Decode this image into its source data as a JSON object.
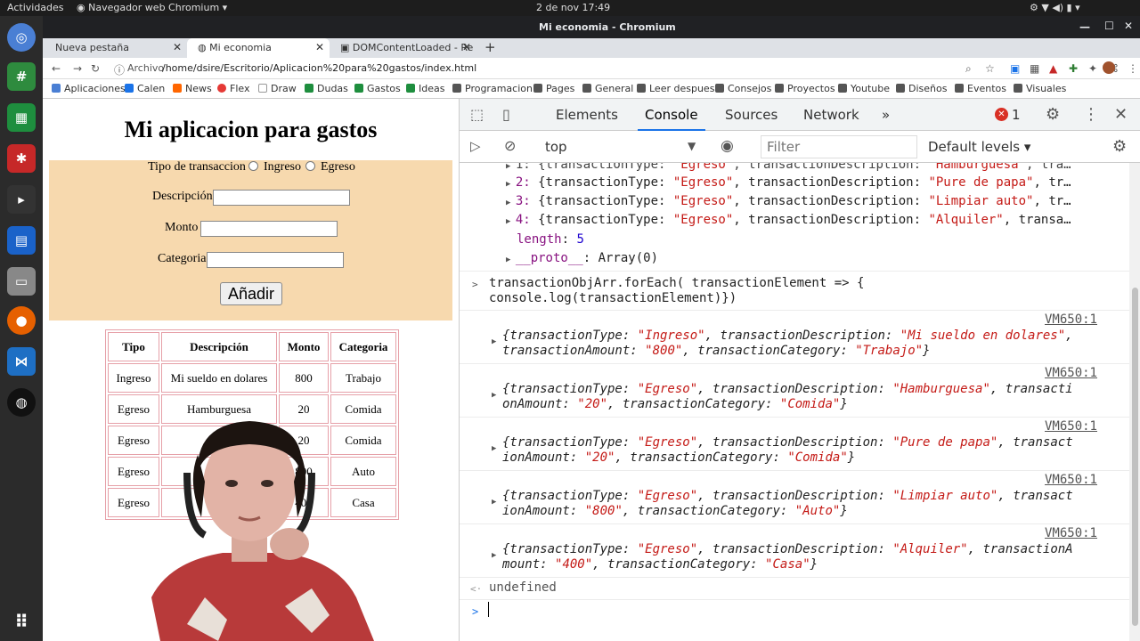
{
  "os": {
    "activities": "Actividades",
    "app_menu": "Navegador web Chromium",
    "clock": "2 de nov  17:49"
  },
  "window": {
    "title": "Mi economia - Chromium"
  },
  "tabs": [
    {
      "label": "Nueva pestaña"
    },
    {
      "label": "Mi economia"
    },
    {
      "label": "DOMContentLoaded - Re"
    }
  ],
  "address": {
    "scheme": "Archivo",
    "url": "/home/dsire/Escritorio/Aplicacion%20para%20gastos/index.html"
  },
  "bookmarks": [
    "Aplicaciones",
    "Calen",
    "News",
    "Flex",
    "Draw",
    "Dudas",
    "Gastos",
    "Ideas",
    "Programacion",
    "Pages",
    "General",
    "Leer despues",
    "Consejos",
    "Proyectos",
    "Youtube",
    "Diseños",
    "Eventos",
    "Visuales"
  ],
  "page": {
    "title": "Mi aplicacion para gastos",
    "form": {
      "type_label": "Tipo de transaccion",
      "opt_ingreso": "Ingreso",
      "opt_egreso": "Egreso",
      "desc_label": "Descripción",
      "amount_label": "Monto",
      "cat_label": "Categoria",
      "add_button": "Añadir"
    },
    "table": {
      "headers": [
        "Tipo",
        "Descripción",
        "Monto",
        "Categoria"
      ],
      "rows": [
        [
          "Ingreso",
          "Mi sueldo en dolares",
          "800",
          "Trabajo"
        ],
        [
          "Egreso",
          "Hamburguesa",
          "20",
          "Comida"
        ],
        [
          "Egreso",
          "",
          "20",
          "Comida"
        ],
        [
          "Egreso",
          "",
          "800",
          "Auto"
        ],
        [
          "Egreso",
          "",
          "400",
          "Casa"
        ]
      ]
    }
  },
  "devtools": {
    "tabs": [
      "Elements",
      "Console",
      "Sources",
      "Network"
    ],
    "error_count": "1",
    "context": "top",
    "filter_placeholder": "Filter",
    "levels": "Default levels",
    "array_items": [
      {
        "idx": "1:",
        "desc": "\"Hamburguesa\""
      },
      {
        "idx": "2:",
        "desc": "\"Pure de papa\""
      },
      {
        "idx": "3:",
        "desc": "\"Limpiar auto\""
      },
      {
        "idx": "4:",
        "desc": "\"Alquiler\""
      }
    ],
    "length": "5",
    "proto": "Array(0)",
    "command_l1": "transactionObjArr.forEach( transactionElement => {",
    "command_l2": "console.log(transactionElement)})",
    "source_link": "VM650:1",
    "logs": [
      {
        "type": "\"Ingreso\"",
        "desc": "\"Mi sueldo en dolares\"",
        "amount": "\"800\"",
        "cat": "\"Trabajo\"",
        "wrap1": "",
        "wrap2": "transactionAmount:"
      },
      {
        "type": "\"Egreso\"",
        "desc": "\"Hamburguesa\"",
        "amount": "\"20\"",
        "cat": "\"Comida\"",
        "wrap1": "transacti",
        "wrap2": "onAmount:"
      },
      {
        "type": "\"Egreso\"",
        "desc": "\"Pure de papa\"",
        "amount": "\"20\"",
        "cat": "\"Comida\"",
        "wrap1": "transact",
        "wrap2": "ionAmount:"
      },
      {
        "type": "\"Egreso\"",
        "desc": "\"Limpiar auto\"",
        "amount": "\"800\"",
        "cat": "\"Auto\"",
        "wrap1": "transact",
        "wrap2": "ionAmount:"
      },
      {
        "type": "\"Egreso\"",
        "desc": "\"Alquiler\"",
        "amount": "\"400\"",
        "cat": "\"Casa\"",
        "wrap1": "transactionA",
        "wrap2": "mount:"
      }
    ],
    "result": "undefined"
  },
  "colors": {
    "form_bg": "#f7d9ae",
    "table_border": "#e6a0a8",
    "devtools_accent": "#1a73e8"
  }
}
